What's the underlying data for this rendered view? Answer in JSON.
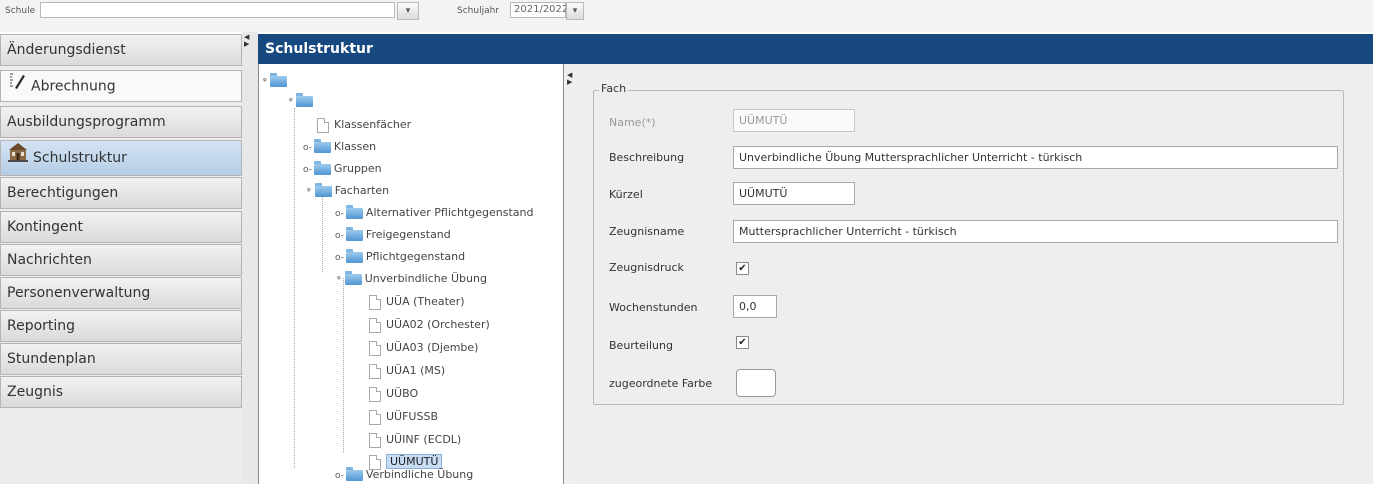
{
  "topbar": {
    "school_label": "Schule",
    "school_value": "",
    "year_label": "Schuljahr",
    "year_value": "2021/2022"
  },
  "sidebar": {
    "items": [
      {
        "label": "Änderungsdienst",
        "icon": ""
      },
      {
        "label": "Abrechnung",
        "icon": "pencil-ruler-icon"
      },
      {
        "label": "Ausbildungsprogramm",
        "icon": ""
      },
      {
        "label": "Schulstruktur",
        "icon": "school-building-icon"
      },
      {
        "label": "Berechtigungen",
        "icon": ""
      },
      {
        "label": "Kontingent",
        "icon": ""
      },
      {
        "label": "Nachrichten",
        "icon": ""
      },
      {
        "label": "Personenverwaltung",
        "icon": ""
      },
      {
        "label": "Reporting",
        "icon": ""
      },
      {
        "label": "Stundenplan",
        "icon": ""
      },
      {
        "label": "Zeugnis",
        "icon": ""
      }
    ]
  },
  "header": {
    "title": "Schulstruktur"
  },
  "tree": {
    "nodes": [
      {
        "label": "Klassenfächer",
        "type": "doc"
      },
      {
        "label": "Klassen",
        "type": "folder"
      },
      {
        "label": "Gruppen",
        "type": "folder"
      },
      {
        "label": "Facharten",
        "type": "folder"
      },
      {
        "label": "Alternativer Pflichtgegenstand",
        "type": "folder"
      },
      {
        "label": "Freigegenstand",
        "type": "folder"
      },
      {
        "label": "Pflichtgegenstand",
        "type": "folder"
      },
      {
        "label": "Unverbindliche Übung",
        "type": "folder"
      },
      {
        "label": "UÜA (Theater)",
        "type": "doc"
      },
      {
        "label": "UÜA02 (Orchester)",
        "type": "doc"
      },
      {
        "label": "UÜA03 (Djembe)",
        "type": "doc"
      },
      {
        "label": "UÜA1 (MS)",
        "type": "doc"
      },
      {
        "label": "UÜBO",
        "type": "doc"
      },
      {
        "label": "UÜFUSSB",
        "type": "doc"
      },
      {
        "label": "UÜINF (ECDL)",
        "type": "doc"
      },
      {
        "label": "UÜMUTÜ",
        "type": "doc",
        "selected": true
      },
      {
        "label": "Verbindliche Übung",
        "type": "folder"
      }
    ]
  },
  "form": {
    "legend": "Fach",
    "name_label": "Name(*)",
    "name_value": "UÜMUTÜ",
    "beschreibung_label": "Beschreibung",
    "beschreibung_value": "Unverbindliche Übung Muttersprachlicher Unterricht - türkisch",
    "kuerzel_label": "Kürzel",
    "kuerzel_value": "UÜMUTÜ",
    "zeugnisname_label": "Zeugnisname",
    "zeugnisname_value": "Muttersprachlicher Unterricht - türkisch",
    "zeugnisdruck_label": "Zeugnisdruck",
    "zeugnisdruck_checked": true,
    "wochenstunden_label": "Wochenstunden",
    "wochenstunden_value": "0,0",
    "beurteilung_label": "Beurteilung",
    "beurteilung_checked": true,
    "farbe_label": "zugeordnete Farbe",
    "farbe_value": "#ffffff"
  },
  "colors": {
    "header_bg": "#17487f",
    "selected_nav": "#b6cde6",
    "folder": "#4f95d2"
  }
}
